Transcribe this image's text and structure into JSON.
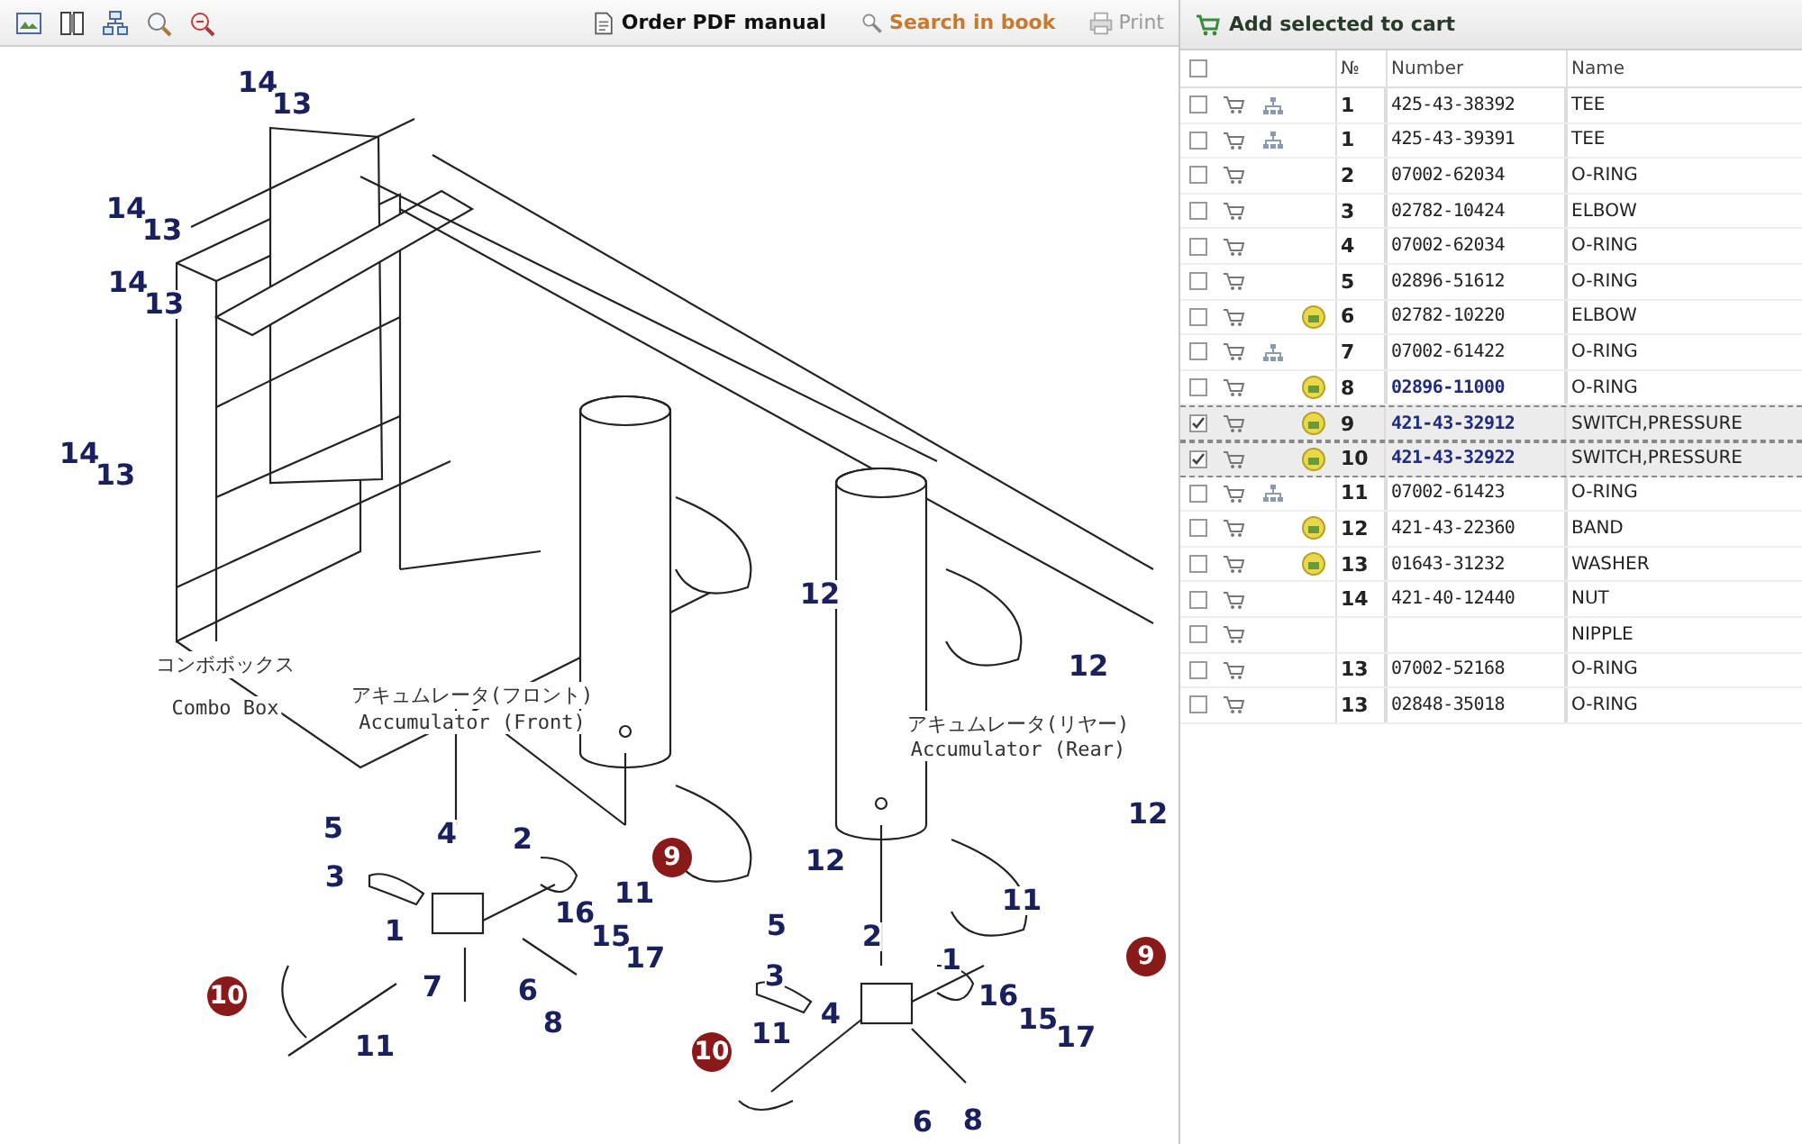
{
  "toolbar": {
    "tools": [
      {
        "kind": "image"
      },
      {
        "kind": "book"
      },
      {
        "kind": "tree"
      },
      {
        "kind": "zoom-in"
      },
      {
        "kind": "zoom-out"
      }
    ],
    "actions": [
      {
        "kind": "pdf",
        "label": "Order PDF manual",
        "disabled": false
      },
      {
        "kind": "search",
        "label": "Search in book",
        "disabled": false
      },
      {
        "kind": "print",
        "label": "Print",
        "disabled": true
      }
    ]
  },
  "diagram": {
    "captions": [
      {
        "text": "コンボボックス"
      },
      {
        "text": "Combo Box"
      },
      {
        "text": "アキュムレータ(フロント)"
      },
      {
        "text": "Accumulator (Front)"
      },
      {
        "text": "アキュムレータ(リヤー)"
      },
      {
        "text": "Accumulator (Rear)"
      }
    ],
    "callouts": [
      {
        "label": "14",
        "kind": "plain"
      },
      {
        "label": "13",
        "kind": "plain"
      },
      {
        "label": "14",
        "kind": "plain"
      },
      {
        "label": "13",
        "kind": "plain"
      },
      {
        "label": "14",
        "kind": "plain"
      },
      {
        "label": "13",
        "kind": "plain"
      },
      {
        "label": "14",
        "kind": "plain"
      },
      {
        "label": "13",
        "kind": "plain"
      },
      {
        "label": "12",
        "kind": "plain"
      },
      {
        "label": "12",
        "kind": "plain"
      },
      {
        "label": "12",
        "kind": "plain"
      },
      {
        "label": "5",
        "kind": "plain"
      },
      {
        "label": "4",
        "kind": "plain"
      },
      {
        "label": "2",
        "kind": "plain"
      },
      {
        "label": "9",
        "kind": "circled"
      },
      {
        "label": "12",
        "kind": "plain"
      },
      {
        "label": "3",
        "kind": "plain"
      },
      {
        "label": "11",
        "kind": "plain"
      },
      {
        "label": "11",
        "kind": "plain"
      },
      {
        "label": "16",
        "kind": "plain"
      },
      {
        "label": "1",
        "kind": "plain"
      },
      {
        "label": "15",
        "kind": "plain"
      },
      {
        "label": "5",
        "kind": "plain"
      },
      {
        "label": "2",
        "kind": "plain"
      },
      {
        "label": "17",
        "kind": "plain"
      },
      {
        "label": "1",
        "kind": "plain"
      },
      {
        "label": "9",
        "kind": "circled"
      },
      {
        "label": "3",
        "kind": "plain"
      },
      {
        "label": "10",
        "kind": "circled"
      },
      {
        "label": "7",
        "kind": "plain"
      },
      {
        "label": "6",
        "kind": "plain"
      },
      {
        "label": "16",
        "kind": "plain"
      },
      {
        "label": "8",
        "kind": "plain"
      },
      {
        "label": "4",
        "kind": "plain"
      },
      {
        "label": "15",
        "kind": "plain"
      },
      {
        "label": "11",
        "kind": "plain"
      },
      {
        "label": "10",
        "kind": "circled"
      },
      {
        "label": "11",
        "kind": "plain"
      },
      {
        "label": "17",
        "kind": "plain"
      },
      {
        "label": "6",
        "kind": "plain"
      },
      {
        "label": "8",
        "kind": "plain"
      }
    ]
  },
  "cart_bar": {
    "label": "Add selected to cart"
  },
  "table": {
    "all_checked": false,
    "columns": [
      "№",
      "Number",
      "Name"
    ],
    "rows": [
      {
        "no": "1",
        "number": "425-43-38392",
        "name": "TEE",
        "checked": false,
        "selected": false,
        "tree": true,
        "info": false,
        "linked": false
      },
      {
        "no": "1",
        "number": "425-43-39391",
        "name": "TEE",
        "checked": false,
        "selected": false,
        "tree": true,
        "info": false,
        "linked": false
      },
      {
        "no": "2",
        "number": "07002-62034",
        "name": "O-RING",
        "checked": false,
        "selected": false,
        "tree": false,
        "info": false,
        "linked": false
      },
      {
        "no": "3",
        "number": "02782-10424",
        "name": "ELBOW",
        "checked": false,
        "selected": false,
        "tree": false,
        "info": false,
        "linked": false
      },
      {
        "no": "4",
        "number": "07002-62034",
        "name": "O-RING",
        "checked": false,
        "selected": false,
        "tree": false,
        "info": false,
        "linked": false
      },
      {
        "no": "5",
        "number": "02896-51612",
        "name": "O-RING",
        "checked": false,
        "selected": false,
        "tree": false,
        "info": false,
        "linked": false
      },
      {
        "no": "6",
        "number": "02782-10220",
        "name": "ELBOW",
        "checked": false,
        "selected": false,
        "tree": false,
        "info": true,
        "linked": false
      },
      {
        "no": "7",
        "number": "07002-61422",
        "name": "O-RING",
        "checked": false,
        "selected": false,
        "tree": true,
        "info": false,
        "linked": false
      },
      {
        "no": "8",
        "number": "02896-11000",
        "name": "O-RING",
        "checked": false,
        "selected": false,
        "tree": false,
        "info": true,
        "linked": true
      },
      {
        "no": "9",
        "number": "421-43-32912",
        "name": "SWITCH,PRESSURE",
        "checked": true,
        "selected": true,
        "tree": false,
        "info": true,
        "linked": true
      },
      {
        "no": "10",
        "number": "421-43-32922",
        "name": "SWITCH,PRESSURE",
        "checked": true,
        "selected": true,
        "tree": false,
        "info": true,
        "linked": true
      },
      {
        "no": "11",
        "number": "07002-61423",
        "name": "O-RING",
        "checked": false,
        "selected": false,
        "tree": true,
        "info": false,
        "linked": false
      },
      {
        "no": "12",
        "number": "421-43-22360",
        "name": "BAND",
        "checked": false,
        "selected": false,
        "tree": false,
        "info": true,
        "linked": false
      },
      {
        "no": "13",
        "number": "01643-31232",
        "name": "WASHER",
        "checked": false,
        "selected": false,
        "tree": false,
        "info": true,
        "linked": false
      },
      {
        "no": "14",
        "number": "421-40-12440",
        "name": "NUT",
        "checked": false,
        "selected": false,
        "tree": false,
        "info": false,
        "linked": false
      },
      {
        "name": "NIPPLE",
        "checked": false,
        "selected": false,
        "tree": false,
        "info": false
      },
      {
        "no": "13",
        "number": "07002-52168",
        "name": "O-RING",
        "checked": false,
        "selected": false,
        "tree": false,
        "info": false,
        "linked": false
      },
      {
        "no": "13",
        "number": "02848-35018",
        "name": "O-RING",
        "checked": false,
        "selected": false,
        "tree": false,
        "info": false,
        "linked": false
      }
    ]
  }
}
